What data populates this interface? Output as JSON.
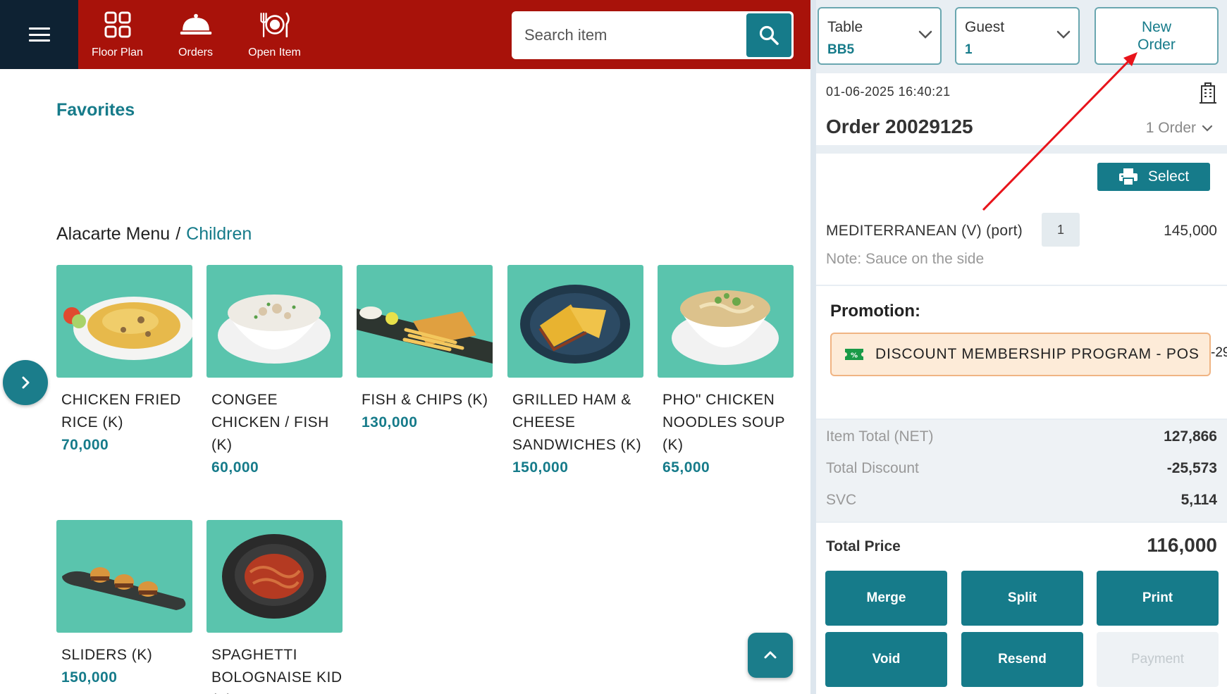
{
  "nav": {
    "items": [
      {
        "label": "Floor Plan",
        "icon": "floor-plan-icon"
      },
      {
        "label": "Orders",
        "icon": "cloche-icon"
      },
      {
        "label": "Open Item",
        "icon": "plate-cutlery-icon"
      }
    ]
  },
  "search": {
    "placeholder": "Search item"
  },
  "sections": {
    "favorites": "Favorites",
    "breadcrumb_root": "Alacarte Menu",
    "breadcrumb_sep": "/",
    "breadcrumb_current": "Children"
  },
  "menu_items": [
    {
      "name": "CHICKEN FRIED RICE (K)",
      "price": "70,000"
    },
    {
      "name": "CONGEE CHICKEN / FISH (K)",
      "price": "60,000"
    },
    {
      "name": "FISH & CHIPS (K)",
      "price": "130,000"
    },
    {
      "name": "GRILLED HAM & CHEESE SANDWICHES (K)",
      "price": "150,000"
    },
    {
      "name": "PHO\" CHICKEN NOODLES SOUP (K)",
      "price": "65,000"
    },
    {
      "name": "SLIDERS (K)",
      "price": "150,000"
    },
    {
      "name": "SPAGHETTI BOLOGNAISE KID (K)",
      "price": ""
    }
  ],
  "order_panel": {
    "table": {
      "label": "Table",
      "value": "BB5"
    },
    "guest": {
      "label": "Guest",
      "value": "1"
    },
    "new_order_label": "New Order",
    "datetime": "01-06-2025 16:40:21",
    "order_title": "Order 20029125",
    "order_count": "1 Order",
    "select_label": "Select",
    "line_items": [
      {
        "name": "MEDITERRANEAN (V) (port)",
        "qty": "1",
        "price": "145,000",
        "note": "Note: Sauce on the side"
      }
    ],
    "promotion_title": "Promotion:",
    "promotion_name": "DISCOUNT MEMBERSHIP PROGRAM - POS",
    "promotion_amount": "-29",
    "summary": [
      {
        "label": "Item Total (NET)",
        "value": "127,866"
      },
      {
        "label": "Total Discount",
        "value": "-25,573"
      },
      {
        "label": "SVC",
        "value": "5,114"
      }
    ],
    "total_label": "Total Price",
    "total_value": "116,000",
    "actions": [
      {
        "label": "Merge",
        "enabled": true
      },
      {
        "label": "Split",
        "enabled": true
      },
      {
        "label": "Print",
        "enabled": true
      },
      {
        "label": "Void",
        "enabled": true
      },
      {
        "label": "Resend",
        "enabled": true
      },
      {
        "label": "Payment",
        "enabled": false
      }
    ]
  },
  "colors": {
    "brand_red": "#a8120a",
    "teal": "#167b8a",
    "navy": "#0e2233",
    "food_bg": "#5ac4ad",
    "promo_bg": "#fdebd8",
    "annotation_arrow": "#e8141b"
  }
}
